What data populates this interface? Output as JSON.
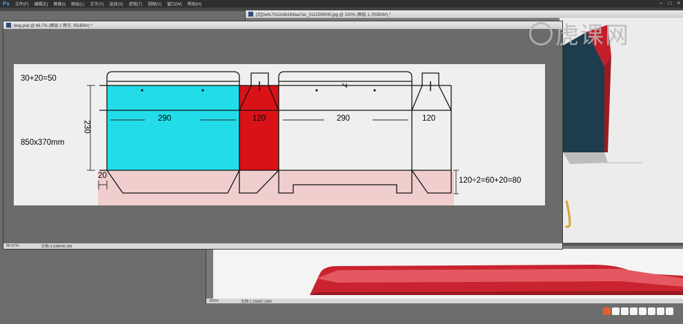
{
  "app": {
    "logo": "Ps",
    "menus": [
      "文件(F)",
      "编辑(E)",
      "图像(I)",
      "图层(L)",
      "文字(Y)",
      "选择(S)",
      "滤镜(T)",
      "视图(V)",
      "窗口(W)",
      "帮助(H)"
    ]
  },
  "documents": {
    "main": {
      "tab": "tiing.psd @ 66.7% (图层 2 拷贝, RGB/8#) *",
      "zoom": "66.67%",
      "doc_info": "文档:4.53M/46.0M"
    },
    "back1": {
      "tab": "[北]0a4c7411b3b1fb8aa7ac_0112508040.jpg @ 100% (图层 1, RGB/8#) *"
    },
    "back2": {
      "zoom": "300%",
      "doc_info": "文档:1.15M/2.20M"
    }
  },
  "watermark": {
    "text": "虎课网"
  },
  "diagram": {
    "label_top": "30+20=50",
    "label_height": "230",
    "label_size": "850x370mm",
    "label_20": "20",
    "label_w1": "290",
    "label_w2": "120",
    "label_w3": "290",
    "label_w4": "120",
    "label_bottom": "120÷2=60+20=80"
  },
  "colors": {
    "cyan": "#22dde9",
    "red": "#d81217",
    "pink": "#f0cece",
    "canvas": "#efefef"
  }
}
